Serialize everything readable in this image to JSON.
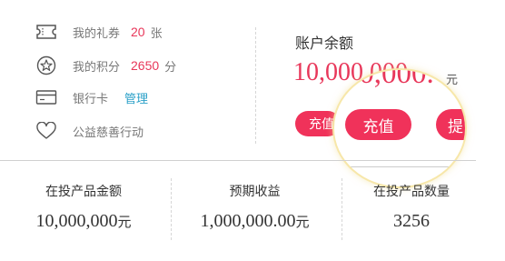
{
  "assets": {
    "coupon": {
      "icon": "ticket-icon",
      "label": "我的礼券",
      "count": "20",
      "unit": "张"
    },
    "points": {
      "icon": "star-badge-icon",
      "label": "我的积分",
      "count": "2650",
      "unit": "分"
    },
    "bank": {
      "icon": "bank-card-icon",
      "label": "银行卡",
      "link": "管理"
    },
    "charity": {
      "icon": "heart-outline-icon",
      "label": "公益慈善行动"
    }
  },
  "balance": {
    "title": "账户余额",
    "amount": "10,000,000.",
    "unit": "元",
    "recharge_label": "充值",
    "withdraw_label": "提"
  },
  "stats": [
    {
      "label": "在投产品金额",
      "value": "10,000,000",
      "unit": "元"
    },
    {
      "label": "预期收益",
      "value": "1,000,000.00",
      "unit": "元"
    },
    {
      "label": "在投产品数量",
      "value": "3256"
    }
  ],
  "colors": {
    "accent": "#f0325a",
    "link": "#2aa0c8",
    "magnifier_border": "#f7e7a9"
  }
}
